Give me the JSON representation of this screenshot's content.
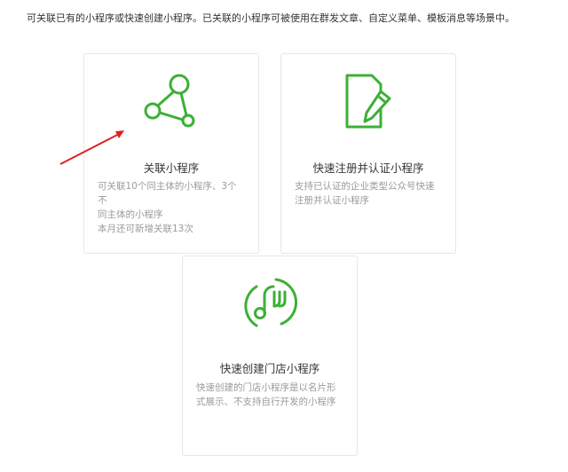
{
  "intro": "可关联已有的小程序或快速创建小程序。已关联的小程序可被使用在群发文章、自定义菜单、模板消息等场景中。",
  "colors": {
    "accent": "#3cb034",
    "arrow": "#e02020",
    "border": "#e7e7eb",
    "desc_text": "#9a9a9a"
  },
  "cards": [
    {
      "title": "关联小程序",
      "icon": "share-nodes-icon",
      "desc_lines": [
        "可关联10个同主体的小程序、3个不",
        "同主体的小程序",
        "本月还可新增关联13次"
      ]
    },
    {
      "title": "快速注册并认证小程序",
      "icon": "document-pen-icon",
      "desc_lines": [
        "支持已认证的企业类型公众号快速",
        "注册并认证小程序"
      ]
    },
    {
      "title": "快速创建门店小程序",
      "icon": "store-fork-icon",
      "desc_lines": [
        "快速创建的门店小程序是以名片形",
        "式展示、不支持自行开发的小程序"
      ]
    }
  ]
}
